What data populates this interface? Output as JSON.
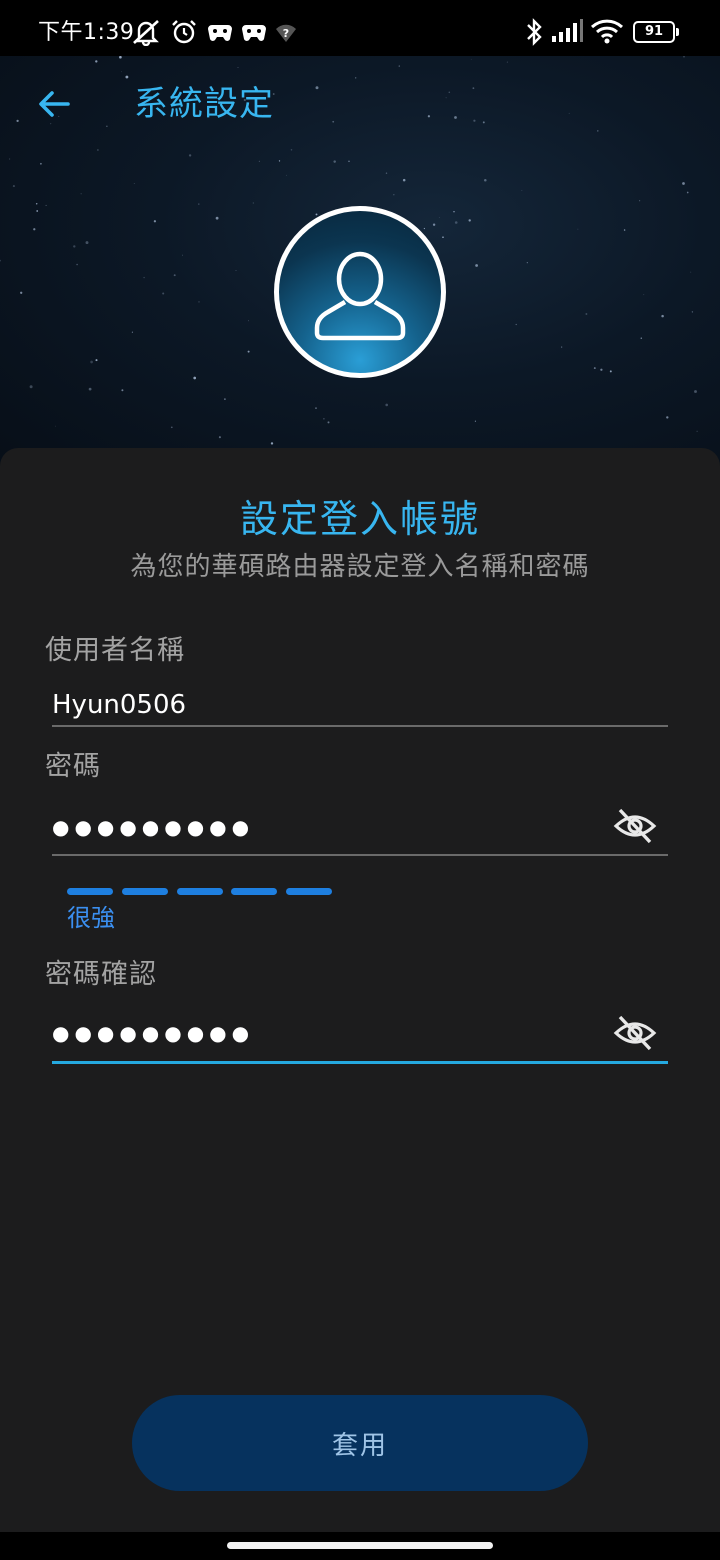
{
  "status_bar": {
    "time": "下午1:39",
    "battery": "91",
    "icons": [
      "mute-icon",
      "alarm-icon",
      "gamepad-icon",
      "gamepad-icon",
      "wifi-question-icon",
      "bluetooth-icon",
      "signal-icon",
      "wifi-icon",
      "battery-icon"
    ]
  },
  "header": {
    "title": "系統設定",
    "back_icon": "arrow-left-icon",
    "accent": "#38b6f0"
  },
  "avatar": {
    "icon": "person-icon"
  },
  "form": {
    "title": "設定登入帳號",
    "subtitle": "為您的華碩路由器設定登入名稱和密碼",
    "username": {
      "label": "使用者名稱",
      "value": "Hyun0506"
    },
    "password": {
      "label": "密碼",
      "value": "●●●●●●●●●",
      "visibility_icon": "eye-off-icon"
    },
    "strength": {
      "label": "很強",
      "level": 5,
      "max": 5,
      "color": "#1e7fe0"
    },
    "confirm": {
      "label": "密碼確認",
      "value": "●●●●●●●●●",
      "visibility_icon": "eye-off-icon"
    },
    "apply_label": "套用"
  }
}
